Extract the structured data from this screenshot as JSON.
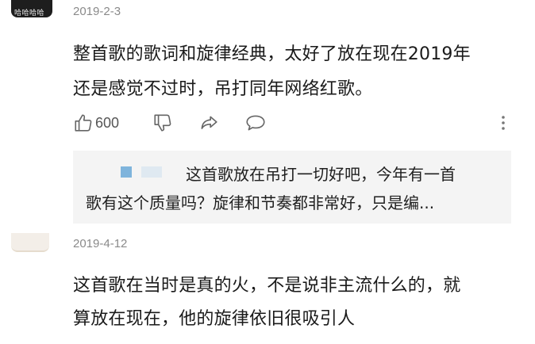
{
  "comments": [
    {
      "avatar_text": "哈哈哈哈",
      "date": "2019-2-3",
      "lines": [
        "整首歌的歌词和旋律经典，太好了放在现在2019年",
        "还是感觉不过时，吊打同年网络红歌。"
      ],
      "likes": "600",
      "reply": {
        "lines": [
          "这首歌放在吊打一切好吧，今年有一首",
          "歌有这个质量吗？旋律和节奏都非常好，只是编..."
        ]
      }
    },
    {
      "date": "2019-4-12",
      "lines": [
        "这首歌在当时是真的火，不是说非主流什么的，就",
        "算放在现在，他的旋律依旧很吸引人"
      ]
    }
  ],
  "icons": {
    "like": "thumbs-up-icon",
    "dislike": "thumbs-down-icon",
    "share": "share-icon",
    "comment": "comment-bubble-icon",
    "more": "more-vertical-icon"
  },
  "colors": {
    "text": "#1a1a1a",
    "muted": "#8a8a8a",
    "icon": "#666666",
    "reply_bg": "#f4f4f4",
    "name_blur": "#7fb4dc"
  }
}
